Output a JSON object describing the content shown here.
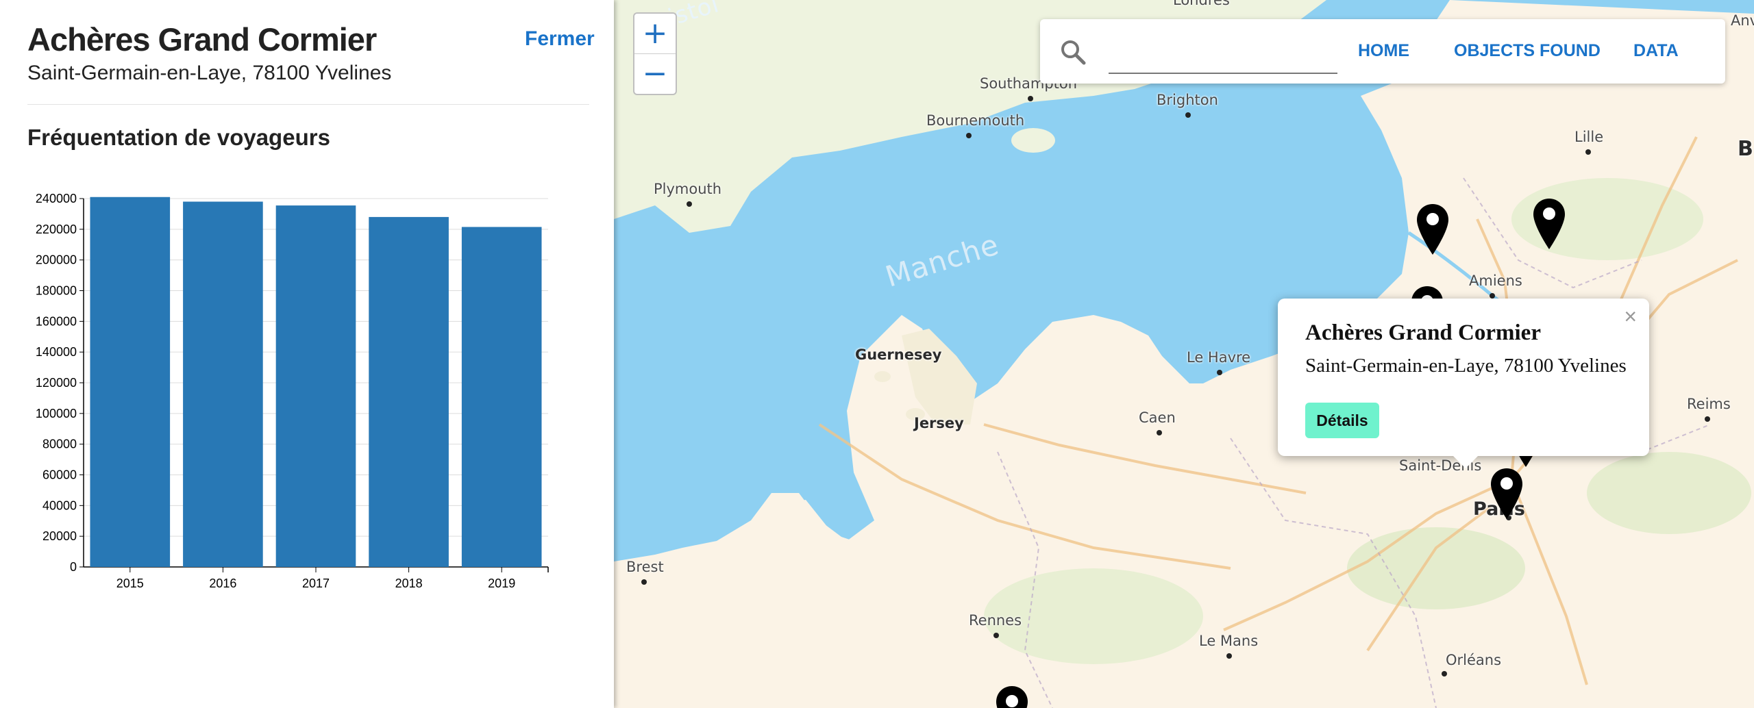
{
  "panel": {
    "title": "Achères Grand Cormier",
    "address": "Saint-Germain-en-Laye, 78100 Yvelines",
    "close_label": "Fermer",
    "chart_title": "Fréquentation de voyageurs"
  },
  "chart_data": {
    "type": "bar",
    "categories": [
      "2015",
      "2016",
      "2017",
      "2018",
      "2019"
    ],
    "values": [
      241000,
      238000,
      235500,
      228000,
      221500
    ],
    "title": "Fréquentation de voyageurs",
    "xlabel": "",
    "ylabel": "",
    "ylim": [
      0,
      240000
    ],
    "yticks": [
      "0",
      "20000",
      "40000",
      "60000",
      "80000",
      "100000",
      "120000",
      "140000",
      "160000",
      "180000",
      "200000",
      "220000",
      "240000"
    ],
    "bar_color": "#2878b5",
    "grid": true
  },
  "map": {
    "zoom_in": "+",
    "zoom_out": "−",
    "sea_label": "Manche",
    "watermark": "Bristol",
    "cities": {
      "southampton": "Southampton",
      "bournemouth": "Bournemouth",
      "brighton": "Brighton",
      "plymouth": "Plymouth",
      "lille": "Lille",
      "amiens": "Amiens",
      "guernesey": "Guernesey",
      "jersey": "Jersey",
      "le_havre": "Le Havre",
      "caen": "Caen",
      "reims": "Reims",
      "saint_denis": "Saint-Denis",
      "paris": "Paris",
      "brest": "Brest",
      "rennes": "Rennes",
      "le_mans": "Le Mans",
      "orleans": "Orléans",
      "londres": "Londres",
      "b_edge": "B",
      "anv": "Anv"
    }
  },
  "topbar": {
    "search_value": "",
    "nav_home": "HOME",
    "nav_objects": "OBJECTS FOUND",
    "nav_data": "DATA"
  },
  "popup": {
    "title": "Achères Grand Cormier",
    "address": "Saint-Germain-en-Laye, 78100 Yvelines",
    "details_label": "Détails",
    "close_glyph": "×"
  },
  "colors": {
    "accent": "#1a73c9",
    "details_button": "#6ff2cd",
    "sea": "#8ed0f2",
    "land": "#fbf3e6"
  }
}
